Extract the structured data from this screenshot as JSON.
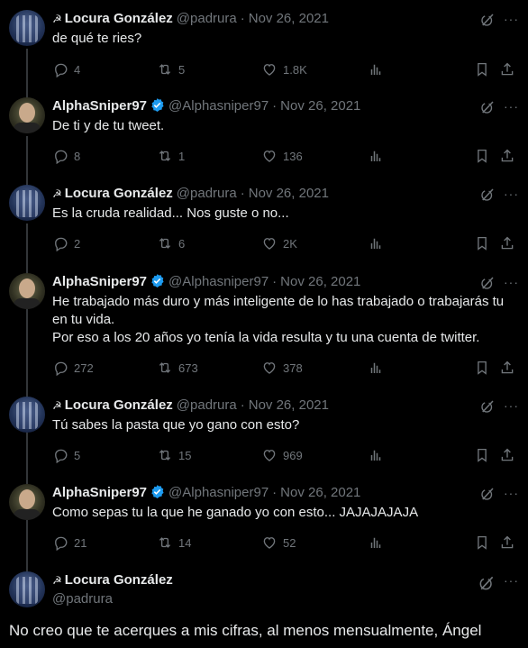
{
  "tweets": [
    {
      "name": "Locura González",
      "handle": "@padrura",
      "date": "Nov 26, 2021",
      "text": "de qué te ries?",
      "replies": "4",
      "retweets": "5",
      "likes": "1.8K",
      "author": "locura"
    },
    {
      "name": "AlphaSniper97",
      "handle": "@Alphasniper97",
      "date": "Nov 26, 2021",
      "text": "De ti y de tu tweet.",
      "replies": "8",
      "retweets": "1",
      "likes": "136",
      "author": "alpha"
    },
    {
      "name": "Locura González",
      "handle": "@padrura",
      "date": "Nov 26, 2021",
      "text": "Es la cruda realidad... Nos guste o no...",
      "replies": "2",
      "retweets": "6",
      "likes": "2K",
      "author": "locura"
    },
    {
      "name": "AlphaSniper97",
      "handle": "@Alphasniper97",
      "date": "Nov 26, 2021",
      "text_line1": "He trabajado más duro y más inteligente de lo has trabajado o trabajarás tu",
      "text_line2": "en tu vida.",
      "text_line3": "Por eso a los 20 años yo tenía la vida resulta y tu una cuenta de twitter.",
      "replies": "272",
      "retweets": "673",
      "likes": "378",
      "author": "alpha"
    },
    {
      "name": "Locura González",
      "handle": "@padrura",
      "date": "Nov 26, 2021",
      "text": "Tú sabes la pasta que yo gano con esto?",
      "replies": "5",
      "retweets": "15",
      "likes": "969",
      "author": "locura"
    },
    {
      "name": "AlphaSniper97",
      "handle": "@Alphasniper97",
      "date": "Nov 26, 2021",
      "text": "Como sepas tu la que he ganado yo con esto... JAJAJAJAJA",
      "replies": "21",
      "retweets": "14",
      "likes": "52",
      "author": "alpha"
    }
  ],
  "main_tweet": {
    "name": "Locura González",
    "handle": "@padrura",
    "text": "No creo que te acerques a mis cifras, al menos mensualmente, Ángel"
  },
  "icons": {
    "reply": "reply-icon",
    "retweet": "retweet-icon",
    "like": "heart-icon",
    "views": "views-icon",
    "bookmark": "bookmark-icon",
    "share": "share-icon",
    "grok": "grok-icon",
    "verified": "verified-badge-icon",
    "hammer": "hammer-sickle-icon"
  },
  "colors": {
    "background": "#000000",
    "text": "#e7e9ea",
    "muted": "#71767b",
    "verified": "#1d9bf0",
    "divider": "#2f3336"
  }
}
